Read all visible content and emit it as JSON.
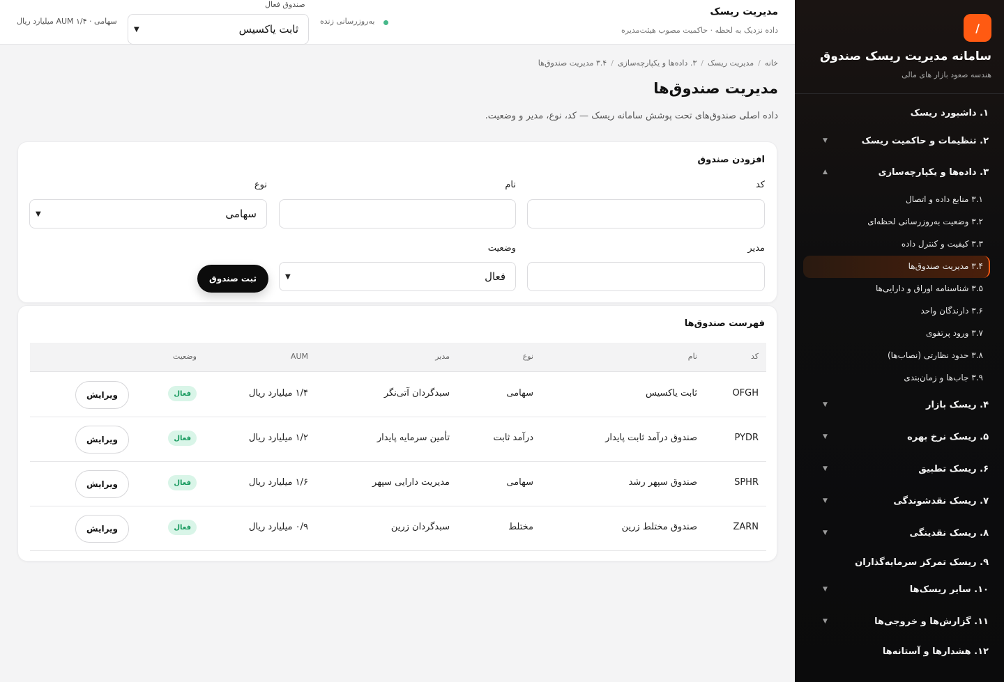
{
  "sidebar": {
    "logo_glyph": "/",
    "brand_title": "سامانه مدیریت ریسک صندوق",
    "brand_subtitle": "هندسه صعود بازار های مالی",
    "items": [
      {
        "label": "۱. داشبورد ریسک",
        "chevron": ""
      },
      {
        "label": "۲. تنظیمات و حاکمیت ریسک",
        "chevron": "▼"
      },
      {
        "label": "۳. داده‌ها و یکپارچه‌سازی",
        "chevron": "▲"
      },
      {
        "label": "۴. ریسک بازار",
        "chevron": "▼"
      },
      {
        "label": "۵. ریسک نرخ بهره",
        "chevron": "▼"
      },
      {
        "label": "۶. ریسک تطبیق",
        "chevron": "▼"
      },
      {
        "label": "۷. ریسک نقدشوندگی",
        "chevron": "▼"
      },
      {
        "label": "۸. ریسک نقدینگی",
        "chevron": "▼"
      },
      {
        "label": "۹. ریسک تمرکز سرمایه‌گذاران",
        "chevron": ""
      },
      {
        "label": "۱۰. سایر ریسک‌ها",
        "chevron": "▼"
      },
      {
        "label": "۱۱. گزارش‌ها و خروجی‌ها",
        "chevron": "▼"
      },
      {
        "label": "۱۲. هشدارها و آستانه‌ها",
        "chevron": ""
      }
    ],
    "subitems": [
      "۳.۱ منابع داده و اتصال",
      "۳.۲ وضعیت به‌روزرسانی لحظه‌ای",
      "۳.۳ کیفیت و کنترل داده",
      "۳.۴ مدیریت صندوق‌ها",
      "۳.۵ شناسنامه اوراق و دارایی‌ها",
      "۳.۶ دارندگان واحد",
      "۳.۷ ورود پرتفوی",
      "۳.۸ حدود نظارتی (نصاب‌ها)",
      "۳.۹ جاب‌ها و زمان‌بندی"
    ]
  },
  "topbar": {
    "title": "مدیریت ریسک",
    "subtitle": "داده نزدیک به لحظه · حاکمیت مصوب هیئت‌مدیره",
    "live_text": "به‌روزرسانی زنده",
    "live_color": "#46b88a",
    "fund_label": "صندوق فعال",
    "fund_value": "ثابت یاکسیس",
    "fund_info": "سهامی · AUM ۱/۴ میلیارد ریال"
  },
  "breadcrumb": [
    "خانه",
    "مدیریت ریسک",
    "۳. داده‌ها و یکپارچه‌سازی",
    "۳.۴ مدیریت صندوق‌ها"
  ],
  "page": {
    "title": "مدیریت صندوق‌ها",
    "description": "داده اصلی صندوق‌های تحت پوشش سامانه ریسک — کد، نوع، مدیر و وضعیت."
  },
  "add_form": {
    "title": "افزودن صندوق",
    "code_label": "کد",
    "code_value": "",
    "name_label": "نام",
    "name_value": "",
    "type_label": "نوع",
    "type_value": "سهامی",
    "manager_label": "مدیر",
    "manager_value": "",
    "status_label": "وضعیت",
    "status_value": "فعال",
    "submit_label": "ثبت صندوق"
  },
  "fund_list": {
    "title": "فهرست صندوق‌ها",
    "columns": [
      "کد",
      "نام",
      "نوع",
      "مدیر",
      "AUM",
      "وضعیت"
    ],
    "edit_label": "ویرایش",
    "rows": [
      {
        "code": "OFGH",
        "name": "ثابت یاکسیس",
        "type": "سهامی",
        "manager": "سبدگردان آتی‌نگر",
        "aum": "۱/۴ میلیارد ریال",
        "status": "فعال"
      },
      {
        "code": "PYDR",
        "name": "صندوق درآمد ثابت پایدار",
        "type": "درآمد ثابت",
        "manager": "تأمین سرمایه پایدار",
        "aum": "۱/۲ میلیارد ریال",
        "status": "فعال"
      },
      {
        "code": "SPHR",
        "name": "صندوق سپهر رشد",
        "type": "سهامی",
        "manager": "مدیریت دارایی سپهر",
        "aum": "۱/۶ میلیارد ریال",
        "status": "فعال"
      },
      {
        "code": "ZARN",
        "name": "صندوق مختلط زرین",
        "type": "مختلط",
        "manager": "سبدگردان زرین",
        "aum": "۰/۹ میلیارد ریال",
        "status": "فعال"
      }
    ]
  },
  "colors": {
    "accent": "#ff5a12",
    "sidebar_bg": "#0e0e0f",
    "status_active_bg": "#d9f5e8",
    "status_active_text": "#179a5e"
  }
}
